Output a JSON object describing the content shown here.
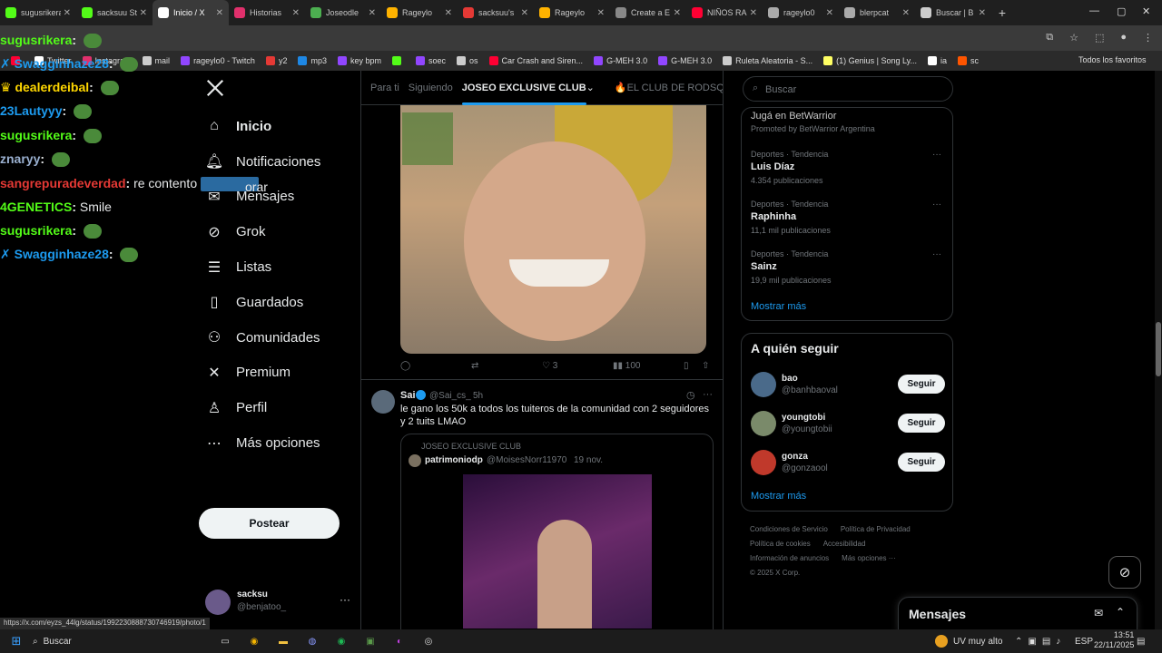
{
  "browser": {
    "tabs": [
      {
        "label": "sugusrikera",
        "icon": "kick-icon",
        "color": "#53fc18"
      },
      {
        "label": "sacksuu St",
        "icon": "kick-icon",
        "color": "#53fc18"
      },
      {
        "label": "Inicio / X",
        "icon": "x-icon",
        "color": "#ffffff",
        "active": true
      },
      {
        "label": "Historias",
        "icon": "instagram-icon",
        "color": "#e1306c"
      },
      {
        "label": "Joseodle",
        "icon": "site-icon",
        "color": "#4caf50"
      },
      {
        "label": "Rageylo",
        "icon": "site-icon",
        "color": "#ffb300"
      },
      {
        "label": "sacksuu's",
        "icon": "site-icon",
        "color": "#e53935"
      },
      {
        "label": "Rageylo",
        "icon": "site-icon",
        "color": "#ffb300"
      },
      {
        "label": "Create a E",
        "icon": "site-icon",
        "color": "#888888"
      },
      {
        "label": "NIÑOS RA",
        "icon": "youtube-icon",
        "color": "#ff0033"
      },
      {
        "label": "rageylo0",
        "icon": "site-icon",
        "color": "#aaaaaa"
      },
      {
        "label": "blerpcat",
        "icon": "site-icon",
        "color": "#aaaaaa"
      },
      {
        "label": "Buscar | B",
        "icon": "site-icon",
        "color": "#cccccc"
      }
    ],
    "new_tab": "+",
    "bookmarks": [
      {
        "label": "",
        "color": "#ff0033"
      },
      {
        "label": "Twitter",
        "color": "#ffffff"
      },
      {
        "label": "Instagram",
        "color": "#e1306c"
      },
      {
        "label": "mail",
        "color": "#cccccc"
      },
      {
        "label": "rageylo0 - Twitch",
        "color": "#9146ff"
      },
      {
        "label": "y2",
        "color": "#e53935"
      },
      {
        "label": "mp3",
        "color": "#1e88e5"
      },
      {
        "label": "key bpm",
        "color": "#9146ff"
      },
      {
        "label": "",
        "color": "#53fc18"
      },
      {
        "label": "soec",
        "color": "#9146ff"
      },
      {
        "label": "os",
        "color": "#cccccc"
      },
      {
        "label": "Car Crash and Siren...",
        "color": "#ff0033"
      },
      {
        "label": "G-MEH 3.0",
        "color": "#9146ff"
      },
      {
        "label": "G-MEH 3.0",
        "color": "#9146ff"
      },
      {
        "label": "Ruleta Aleatoria - S...",
        "color": "#cccccc"
      },
      {
        "label": "(1) Genius | Song Ly...",
        "color": "#ffff64"
      },
      {
        "label": "ia",
        "color": "#ffffff"
      },
      {
        "label": "sc",
        "color": "#ff5500"
      }
    ],
    "all_bookmarks": "Todos los favoritos"
  },
  "chat": {
    "messages": [
      {
        "user": "sugusrikera",
        "color": "#53fc18",
        "text": ""
      },
      {
        "user": "Swagginhaze28",
        "color": "#1d9bf0",
        "text": ""
      },
      {
        "user": "dealerdeibal",
        "color": "#ffd700",
        "text": ""
      },
      {
        "user": "23Lautyyy",
        "color": "#1d9bf0",
        "text": ""
      },
      {
        "user": "sugusrikera",
        "color": "#53fc18",
        "text": ""
      },
      {
        "user": "znaryy",
        "color": "#9ab0d0",
        "text": ""
      },
      {
        "user": "sangrepuradeverdad",
        "color": "#e53935",
        "text": "re contento"
      },
      {
        "user": "4GENETICS",
        "color": "#53fc18",
        "text": "Smile"
      },
      {
        "user": "sugusrikera",
        "color": "#53fc18",
        "text": ""
      },
      {
        "user": "Swagginhaze28",
        "color": "#1d9bf0",
        "text": ""
      }
    ],
    "partial": "orar"
  },
  "nav": {
    "items": [
      {
        "label": "Inicio",
        "icon": "home-icon",
        "bold": true
      },
      {
        "label": "Notificaciones",
        "icon": "bell-icon"
      },
      {
        "label": "Mensajes",
        "icon": "mail-icon"
      },
      {
        "label": "Grok",
        "icon": "grok-icon"
      },
      {
        "label": "Listas",
        "icon": "list-icon"
      },
      {
        "label": "Guardados",
        "icon": "bookmark-icon"
      },
      {
        "label": "Comunidades",
        "icon": "communities-icon"
      },
      {
        "label": "Premium",
        "icon": "x-icon"
      },
      {
        "label": "Perfil",
        "icon": "person-icon"
      },
      {
        "label": "Más opciones",
        "icon": "more-icon"
      }
    ],
    "post_button": "Postear",
    "account": {
      "name": "sacksu",
      "handle": "@benjatoo_"
    }
  },
  "feed": {
    "tabs": [
      "Para ti",
      "Siguiendo",
      "JOSEO EXCLUSIVE CLUB",
      "🔥EL CLUB DE RODSQU"
    ],
    "first_post_actions": {
      "likes": "3",
      "views": "100"
    },
    "post": {
      "author": "Sai",
      "handle": "@Sai_cs_",
      "time": "5h",
      "text": "le gano los 50k a todos los tuiteros de la comunidad con 2 seguidores y 2 tuits LMAO",
      "quote": {
        "community": "JOSEO EXCLUSIVE CLUB",
        "author": "patrimoniodp",
        "handle": "@MoisesNorr11970",
        "date": "19 nov."
      }
    },
    "status_url": "https://x.com/eyzs_44lg/status/1992230888730746919/photo/1"
  },
  "sidebar": {
    "search_placeholder": "Buscar",
    "promo": {
      "title": "Jugá en BetWarrior",
      "sub": "Promoted by BetWarrior Argentina"
    },
    "trends": [
      {
        "category": "Deportes · Tendencia",
        "name": "Luis Díaz",
        "count": "4.354 publicaciones"
      },
      {
        "category": "Deportes · Tendencia",
        "name": "Raphinha",
        "count": "11,1 mil publicaciones"
      },
      {
        "category": "Deportes · Tendencia",
        "name": "Sainz",
        "count": "19,9 mil publicaciones"
      }
    ],
    "show_more": "Mostrar más",
    "who_to_follow": "A quién seguir",
    "follow": [
      {
        "name": "bao",
        "handle": "@banhbaoval",
        "color": "#4a6a8a"
      },
      {
        "name": "youngtobi",
        "handle": "@youngtobii",
        "color": "#7a8a6a"
      },
      {
        "name": "gonza",
        "handle": "@gonzaool",
        "color": "#c0392b"
      }
    ],
    "follow_button": "Seguir",
    "footer": [
      "Condiciones de Servicio",
      "Política de Privacidad",
      "Política de cookies",
      "Accesibilidad",
      "Información de anuncios",
      "Más opciones ···",
      "© 2025 X Corp."
    ],
    "messages": "Mensajes"
  },
  "taskbar": {
    "search": "Buscar",
    "weather": "UV muy alto",
    "lang": "ESP",
    "time": "13:51",
    "date": "22/11/2025"
  }
}
